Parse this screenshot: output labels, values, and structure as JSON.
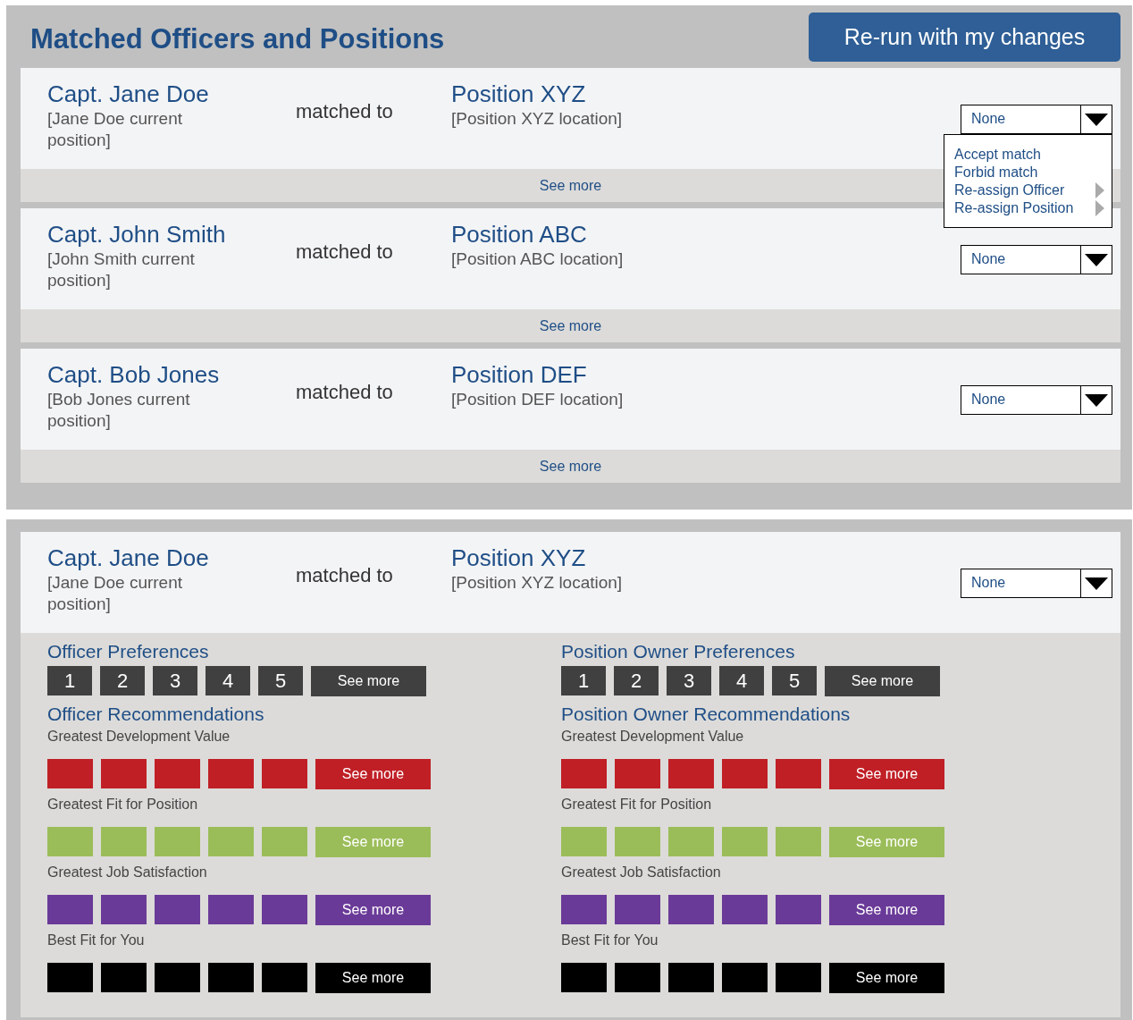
{
  "header": {
    "title": "Matched Officers and Positions",
    "button": "Re-run with my changes"
  },
  "matches": [
    {
      "officer": {
        "name": "Capt. Jane Doe",
        "position": "[Jane Doe current position]"
      },
      "connector": "matched to",
      "position": {
        "title": "Position XYZ",
        "location": "[Position XYZ location]"
      },
      "action": {
        "value": "None",
        "menu_open": true,
        "menu": [
          {
            "label": "Accept match",
            "submenu": false
          },
          {
            "label": "Forbid match",
            "submenu": false
          },
          {
            "label": "Re-assign Officer",
            "submenu": true
          },
          {
            "label": "Re-assign Position",
            "submenu": true
          }
        ]
      },
      "see_more": "See more"
    },
    {
      "officer": {
        "name": "Capt. John Smith",
        "position": "[John Smith current position]"
      },
      "connector": "matched to",
      "position": {
        "title": "Position ABC",
        "location": "[Position ABC location]"
      },
      "action": {
        "value": "None",
        "menu_open": false
      },
      "see_more": "See more"
    },
    {
      "officer": {
        "name": "Capt. Bob Jones",
        "position": "[Bob Jones current position]"
      },
      "connector": "matched to",
      "position": {
        "title": "Position DEF",
        "location": "[Position DEF location]"
      },
      "action": {
        "value": "None",
        "menu_open": false
      },
      "see_more": "See more"
    }
  ],
  "detail": {
    "officer": {
      "name": "Capt. Jane Doe",
      "position": "[Jane Doe current position]"
    },
    "connector": "matched to",
    "position": {
      "title": "Position XYZ",
      "location": "[Position XYZ location]"
    },
    "action": {
      "value": "None",
      "menu_open": false
    },
    "panels": [
      {
        "preferences": {
          "title": "Officer Preferences",
          "ranks": [
            "1",
            "2",
            "3",
            "4",
            "5"
          ],
          "see_more": "See more"
        },
        "recommendations": {
          "title": "Officer Recommendations",
          "groups": [
            {
              "label": "Greatest Development Value",
              "color": "#c01f26",
              "see_more": "See more"
            },
            {
              "label": "Greatest Fit for Position",
              "color": "#9bbd59",
              "see_more": "See more"
            },
            {
              "label": "Greatest Job Satisfaction",
              "color": "#6a3a98",
              "see_more": "See more"
            },
            {
              "label": "Best Fit for You",
              "color": "#000000",
              "see_more": "See more"
            }
          ]
        }
      },
      {
        "preferences": {
          "title": "Position Owner Preferences",
          "ranks": [
            "1",
            "2",
            "3",
            "4",
            "5"
          ],
          "see_more": "See more"
        },
        "recommendations": {
          "title": "Position Owner Recommendations",
          "groups": [
            {
              "label": "Greatest Development Value",
              "color": "#c01f26",
              "see_more": "See more"
            },
            {
              "label": "Greatest Fit for Position",
              "color": "#9bbd59",
              "see_more": "See more"
            },
            {
              "label": "Greatest Job Satisfaction",
              "color": "#6a3a98",
              "see_more": "See more"
            },
            {
              "label": "Best Fit for You",
              "color": "#000000",
              "see_more": "See more"
            }
          ]
        }
      }
    ]
  }
}
